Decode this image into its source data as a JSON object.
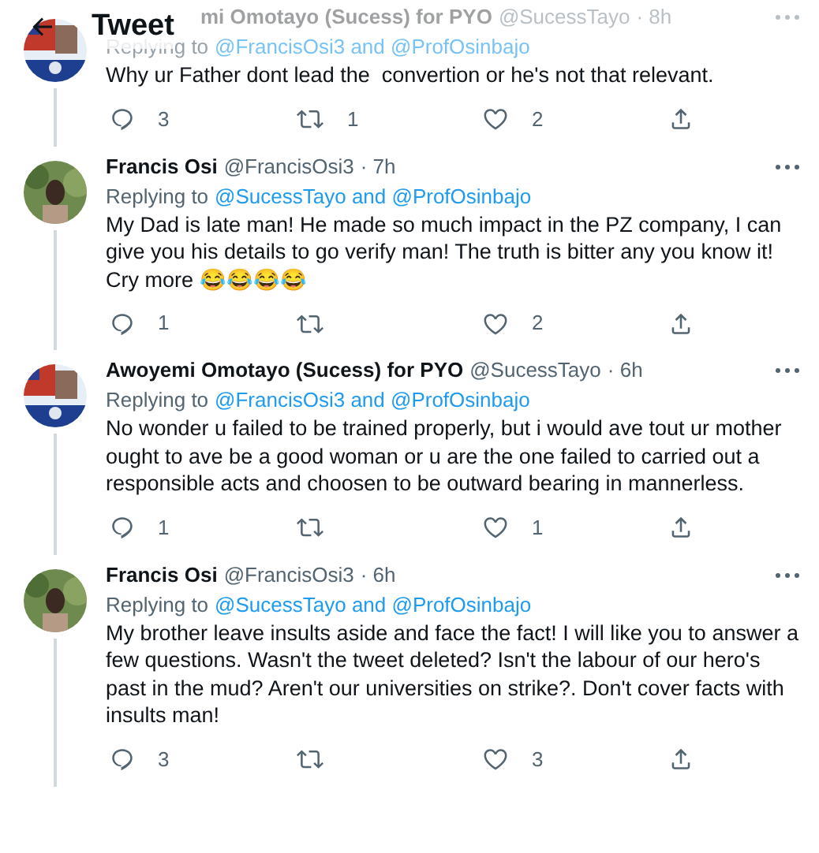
{
  "header": {
    "title": "Tweet"
  },
  "tweets": [
    {
      "name": "mi Omotayo (Sucess) for PYO",
      "handle": "@SucessTayo",
      "time": "· 8h",
      "replying_prefix": "Replying to",
      "replying_to": "@FrancisOsi3 and @ProfOsinbajo",
      "text": "Why ur Father dont lead the  convertion or he's not that relevant.",
      "replies": "3",
      "retweets": "1",
      "likes": "2"
    },
    {
      "name": "Francis Osi",
      "handle": "@FrancisOsi3",
      "time": "· 7h",
      "replying_prefix": "Replying to",
      "replying_to": "@SucessTayo and @ProfOsinbajo",
      "text": "My Dad is late man! He made so much impact in the PZ company, I can give you his details to go verify man! The truth is bitter any you know it! Cry more 😂😂😂😂",
      "replies": "1",
      "likes": "2"
    },
    {
      "name": "Awoyemi Omotayo (Sucess) for PYO",
      "handle": "@SucessTayo",
      "time": "· 6h",
      "replying_prefix": "Replying to",
      "replying_to": "@FrancisOsi3 and @ProfOsinbajo",
      "text": "No wonder u failed to be trained properly, but i would ave tout ur mother ought to ave be a good woman or u are the one failed to carried out a responsible acts and choosen to be outward bearing in mannerless.",
      "replies": "1",
      "likes": "1"
    },
    {
      "name": "Francis Osi",
      "handle": "@FrancisOsi3",
      "time": "· 6h",
      "replying_prefix": "Replying to",
      "replying_to": "@SucessTayo and @ProfOsinbajo",
      "text": "My brother leave insults aside and face the fact! I will like you to answer a few questions. Wasn't the tweet deleted? Isn't the labour of our hero's past in the mud? Aren't our universities on strike?. Don't cover facts with insults man!",
      "replies": "3",
      "likes": "3"
    }
  ]
}
